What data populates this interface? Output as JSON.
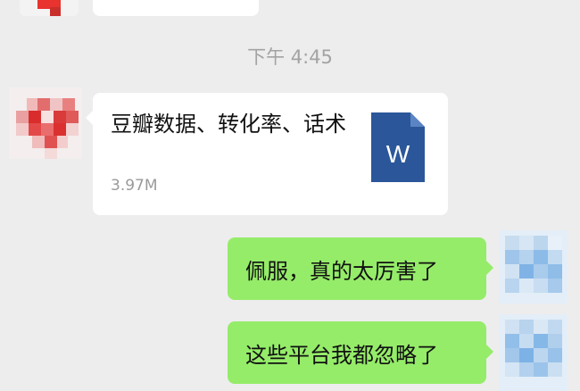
{
  "chat": {
    "timestamp": "下午 4:45",
    "file_message": {
      "title": "豆瓣数据、转化率、话术",
      "size": "3.97M",
      "icon": "word-document-icon",
      "icon_letter": "W",
      "icon_color": "#2b579a"
    },
    "messages": [
      {
        "text": "佩服，真的太厉害了",
        "side": "right"
      },
      {
        "text": "这些平台我都忽略了",
        "side": "right"
      }
    ]
  },
  "colors": {
    "background": "#ededed",
    "incoming_bubble": "#ffffff",
    "outgoing_bubble": "#95ec69",
    "timestamp": "#a3a3a3"
  }
}
